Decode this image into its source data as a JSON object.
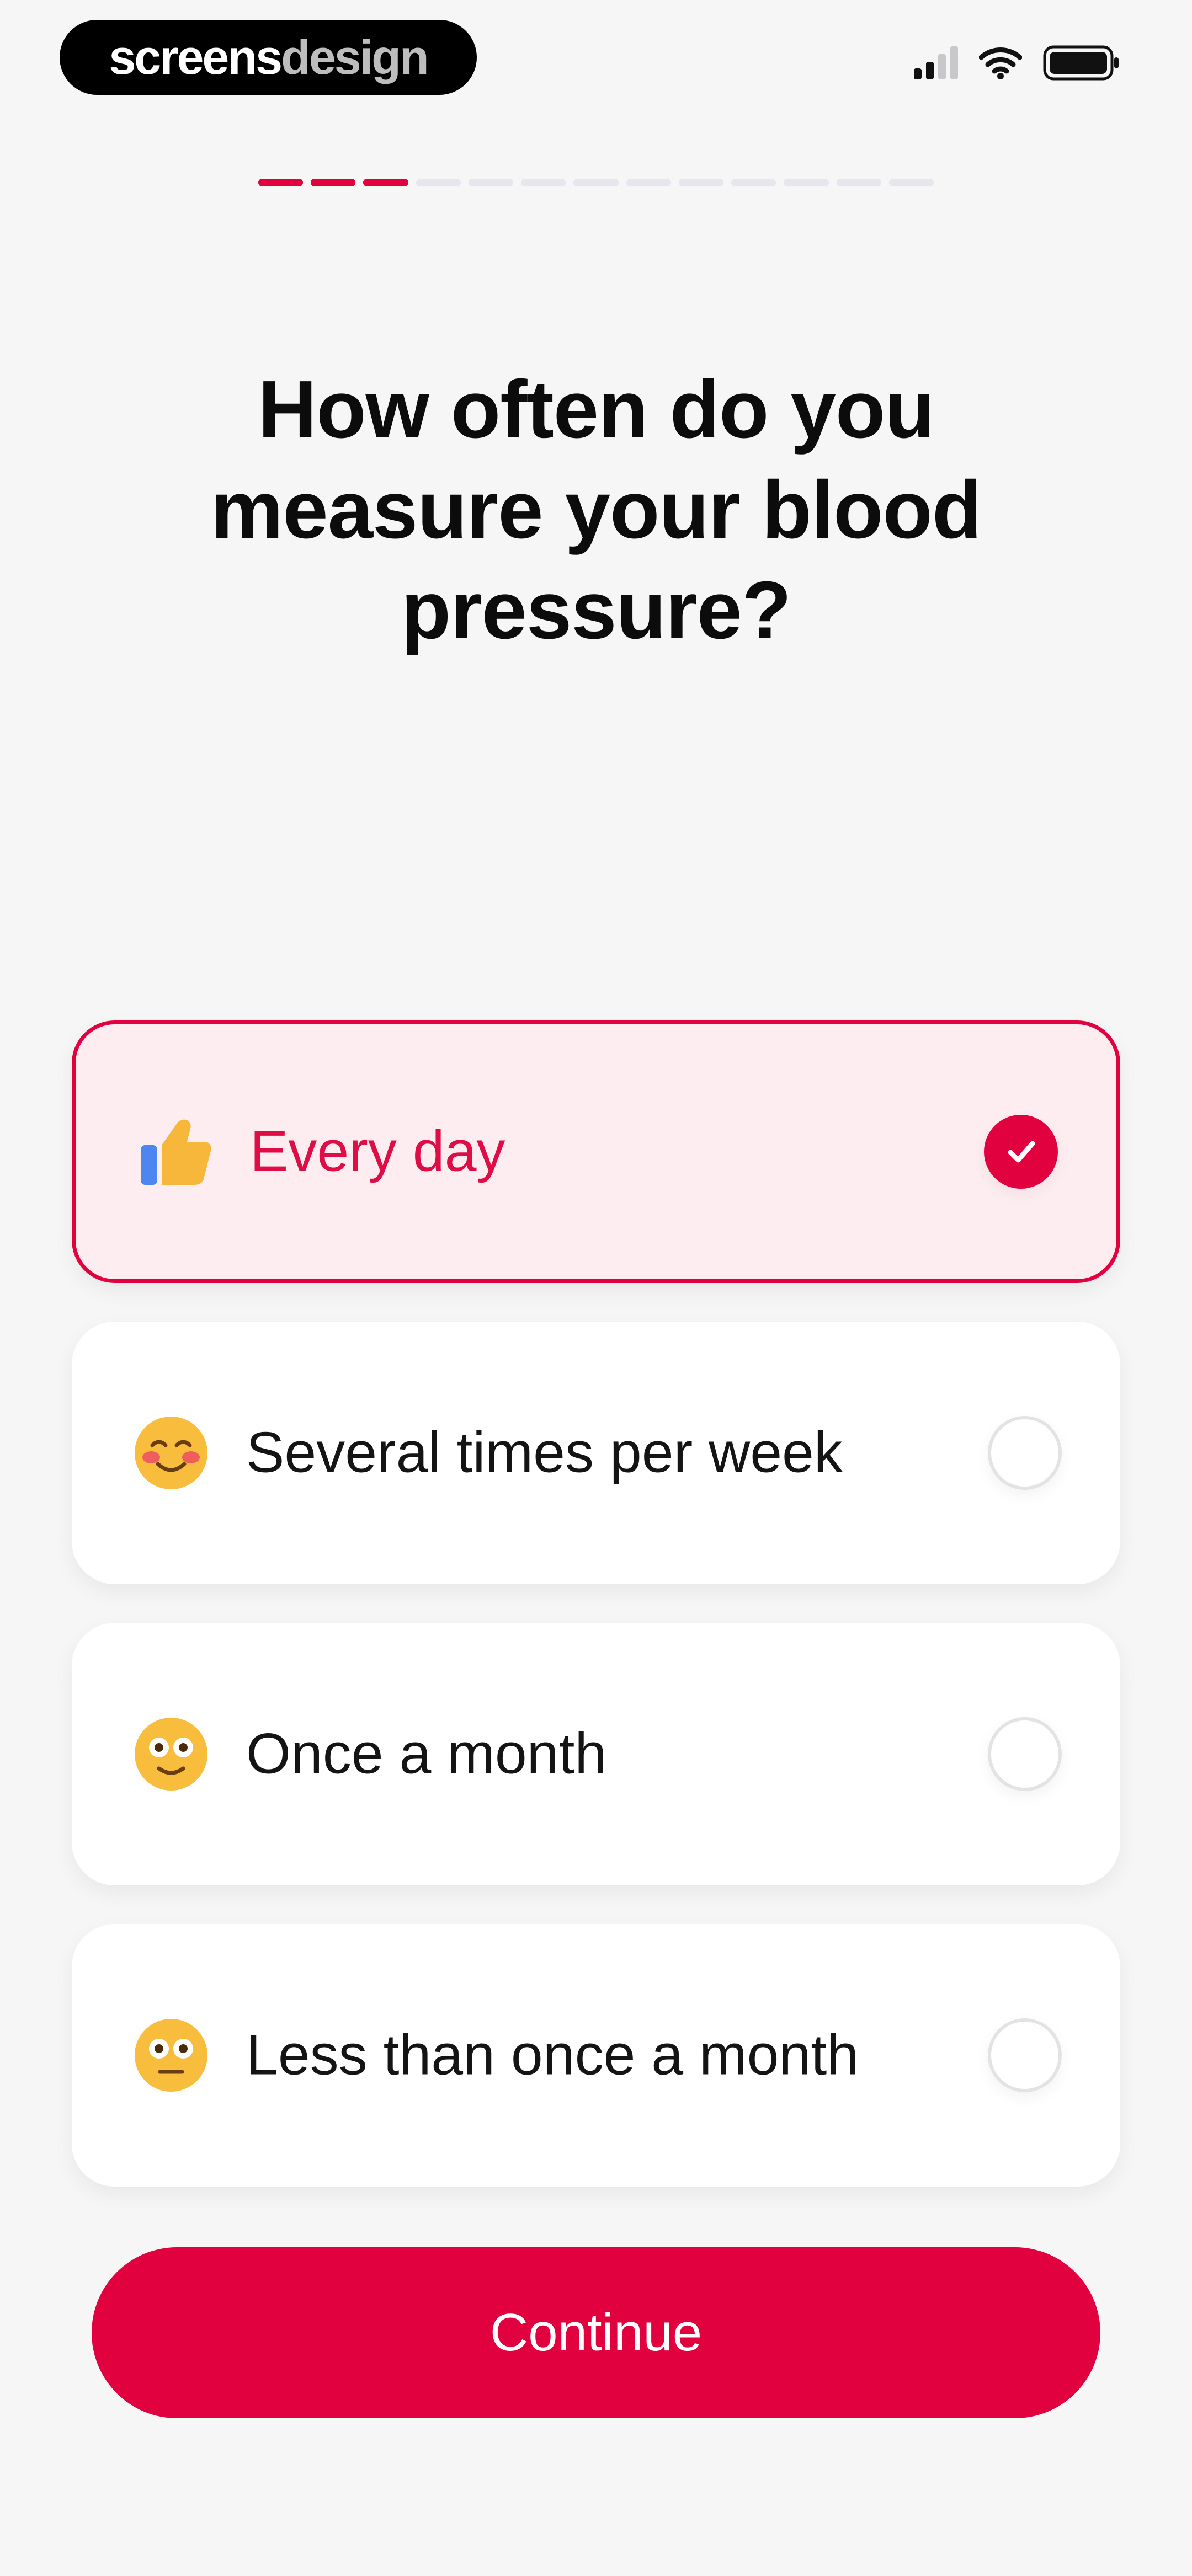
{
  "brand": {
    "part1": "screens",
    "part2": "design"
  },
  "status_bar": {
    "icons": [
      "cellular-signal-icon",
      "wifi-icon",
      "battery-icon"
    ]
  },
  "progress": {
    "total_steps": 13,
    "current_step": 3
  },
  "question": {
    "title": "How often do you measure your blood pressure?"
  },
  "options": [
    {
      "label": "Every day",
      "emoji": "thumbs-up-icon",
      "selected": true
    },
    {
      "label": "Several times per week",
      "emoji": "smiling-face-icon",
      "selected": false
    },
    {
      "label": "Once a month",
      "emoji": "wide-eyed-face-icon",
      "selected": false
    },
    {
      "label": "Less than once a month",
      "emoji": "neutral-face-icon",
      "selected": false
    }
  ],
  "continue_button": {
    "label": "Continue"
  },
  "colors": {
    "accent": "#e2013f",
    "selected_background": "#fdecf0",
    "page_background": "#f6f6f7",
    "inactive_progress": "#e6e7ec"
  }
}
